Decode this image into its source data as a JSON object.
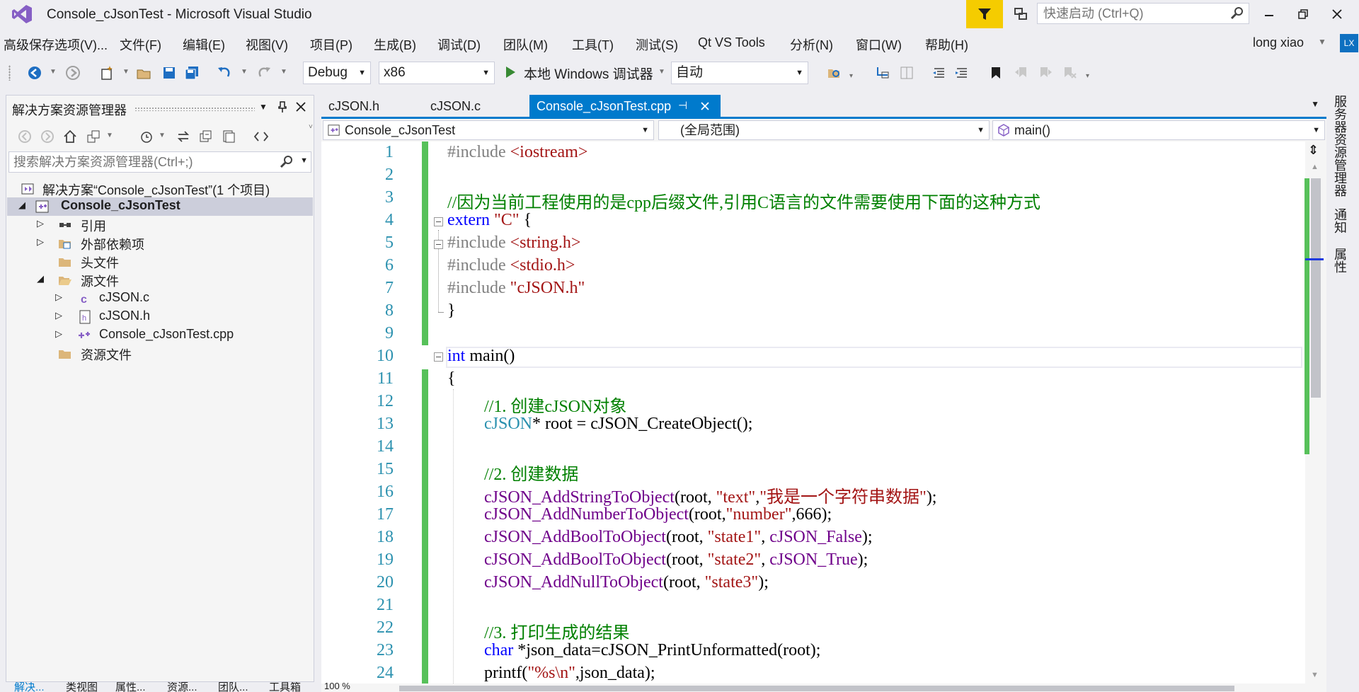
{
  "window": {
    "title": "Console_cJsonTest - Microsoft Visual Studio",
    "quick_launch_placeholder": "快速启动 (Ctrl+Q)"
  },
  "menu": [
    "高级保存选项(V)...",
    "文件(F)",
    "编辑(E)",
    "视图(V)",
    "项目(P)",
    "生成(B)",
    "调试(D)",
    "团队(M)",
    "工具(T)",
    "测试(S)",
    "Qt VS Tools",
    "分析(N)",
    "窗口(W)",
    "帮助(H)"
  ],
  "account": {
    "name": "long xiao",
    "initials": "LX"
  },
  "toolbar": {
    "config": "Debug",
    "platform": "x86",
    "run_label": "本地 Windows 调试器",
    "run_mode": "自动"
  },
  "solution_explorer": {
    "title": "解决方案资源管理器",
    "search_placeholder": "搜索解决方案资源管理器(Ctrl+;)",
    "tree": [
      {
        "label": "解决方案“Console_cJsonTest”(1 个项目)",
        "icon": "solution-icon"
      },
      {
        "label": "Console_cJsonTest",
        "icon": "cpp-project-icon",
        "selected": true
      },
      {
        "label": "引用",
        "icon": "references-icon"
      },
      {
        "label": "外部依赖项",
        "icon": "external-deps-icon"
      },
      {
        "label": "头文件",
        "icon": "folder-icon"
      },
      {
        "label": "源文件",
        "icon": "folder-open-icon"
      },
      {
        "label": "cJSON.c",
        "icon": "c-file-icon"
      },
      {
        "label": "cJSON.h",
        "icon": "h-file-icon"
      },
      {
        "label": "Console_cJsonTest.cpp",
        "icon": "cpp-file-icon"
      },
      {
        "label": "资源文件",
        "icon": "folder-icon"
      }
    ],
    "bottom_tabs": [
      "解决...",
      "类视图",
      "属性...",
      "资源...",
      "团队...",
      "工具箱"
    ]
  },
  "editor": {
    "tabs": [
      "cJSON.h",
      "cJSON.c",
      "Console_cJsonTest.cpp"
    ],
    "active_tab": "Console_cJsonTest.cpp",
    "nav_project": "Console_cJsonTest",
    "nav_scope": "(全局范围)",
    "nav_member": "main()",
    "zoom": "100 %",
    "line_numbers": [
      "1",
      "2",
      "3",
      "4",
      "5",
      "6",
      "7",
      "8",
      "9",
      "10",
      "11",
      "12",
      "13",
      "14",
      "15",
      "16",
      "17",
      "18",
      "19",
      "20",
      "21",
      "22",
      "23",
      "24"
    ],
    "lines": {
      "l1a": "#include ",
      "l1b": "<iostream>",
      "l3": "//因为当前工程使用的是cpp后缀文件,引用C语言的文件需要使用下面的这种方式",
      "l4a": "extern ",
      "l4b": "\"C\"",
      "l4c": " {",
      "l5a": "#include ",
      "l5b": "<string.h>",
      "l6a": "#include ",
      "l6b": "<stdio.h>",
      "l7a": "#include ",
      "l7b": "\"cJSON.h\"",
      "l8": "}",
      "l10a": "int",
      "l10b": " main()",
      "l11": "{",
      "l12": "//1. 创建cJSON对象",
      "l13a": "cJSON",
      "l13b": "* root = cJSON_CreateObject();",
      "l15": "//2. 创建数据",
      "l16a": "cJSON_AddStringToObject",
      "l16b": "(root, ",
      "l16c": "\"text\"",
      "l16d": ",",
      "l16e": "\"我是一个字符串数据\"",
      "l16f": ");",
      "l17a": "cJSON_AddNumberToObject",
      "l17b": "(root,",
      "l17c": "\"number\"",
      "l17d": ",666);",
      "l18a": "cJSON_AddBoolToObject",
      "l18b": "(root, ",
      "l18c": "\"state1\"",
      "l18d": ", ",
      "l18e": "cJSON_False",
      "l18f": ");",
      "l19a": "cJSON_AddBoolToObject",
      "l19b": "(root, ",
      "l19c": "\"state2\"",
      "l19d": ", ",
      "l19e": "cJSON_True",
      "l19f": ");",
      "l20a": "cJSON_AddNullToObject",
      "l20b": "(root, ",
      "l20c": "\"state3\"",
      "l20d": ");",
      "l22": "//3. 打印生成的结果",
      "l23a": "char",
      "l23b": " *json_data=cJSON_PrintUnformatted(root);",
      "l24a": "printf(",
      "l24b": "\"%s\\n\"",
      "l24c": ",json_data);"
    }
  },
  "right_rail": [
    "服务器资源管理器",
    "通知",
    "属性"
  ],
  "colors": {
    "accent": "#007ACC",
    "change_bar": "#57C15A",
    "filter_button": "#F5CC00",
    "keyword": "#0000FF",
    "string": "#A31515",
    "comment": "#008000",
    "type": "#2B91AF"
  }
}
